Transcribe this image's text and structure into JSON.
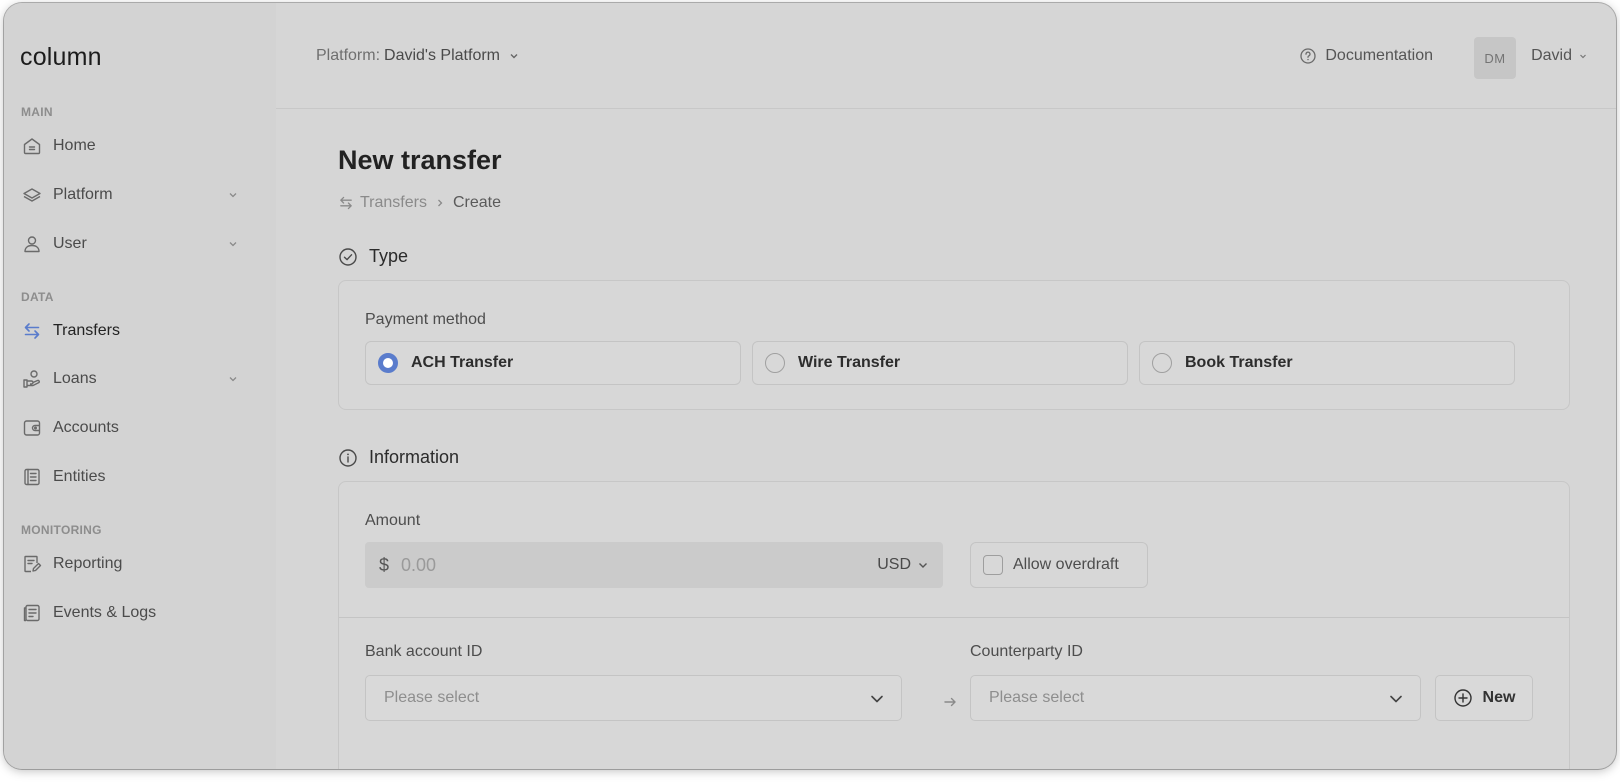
{
  "sidebar": {
    "logo": "column",
    "sections": {
      "main": "MAIN",
      "data": "DATA",
      "monitoring": "MONITORING"
    },
    "items": {
      "home": "Home",
      "platform": "Platform",
      "user": "User",
      "transfers": "Transfers",
      "loans": "Loans",
      "accounts": "Accounts",
      "entities": "Entities",
      "reporting": "Reporting",
      "events_logs": "Events & Logs"
    },
    "active_item": "Transfers",
    "accent_color": "#5a7ccc"
  },
  "topbar": {
    "platform_label": "Platform:",
    "platform_value": "David's Platform",
    "documentation": "Documentation",
    "avatar_initials": "DM",
    "user_name": "David"
  },
  "page": {
    "title": "New transfer",
    "breadcrumb": {
      "parent": "Transfers",
      "current": "Create"
    }
  },
  "type_section": {
    "heading": "Type",
    "payment_method_label": "Payment method",
    "options": {
      "ach": "ACH Transfer",
      "wire": "Wire Transfer",
      "book": "Book Transfer"
    },
    "selected": "ACH Transfer"
  },
  "information_section": {
    "heading": "Information",
    "amount_label": "Amount",
    "currency_symbol": "$",
    "amount_placeholder": "0.00",
    "currency": "USD",
    "allow_overdraft": "Allow overdraft",
    "bank_account_label": "Bank account ID",
    "bank_account_placeholder": "Please select",
    "counterparty_label": "Counterparty ID",
    "counterparty_placeholder": "Please select",
    "new_button": "New"
  }
}
